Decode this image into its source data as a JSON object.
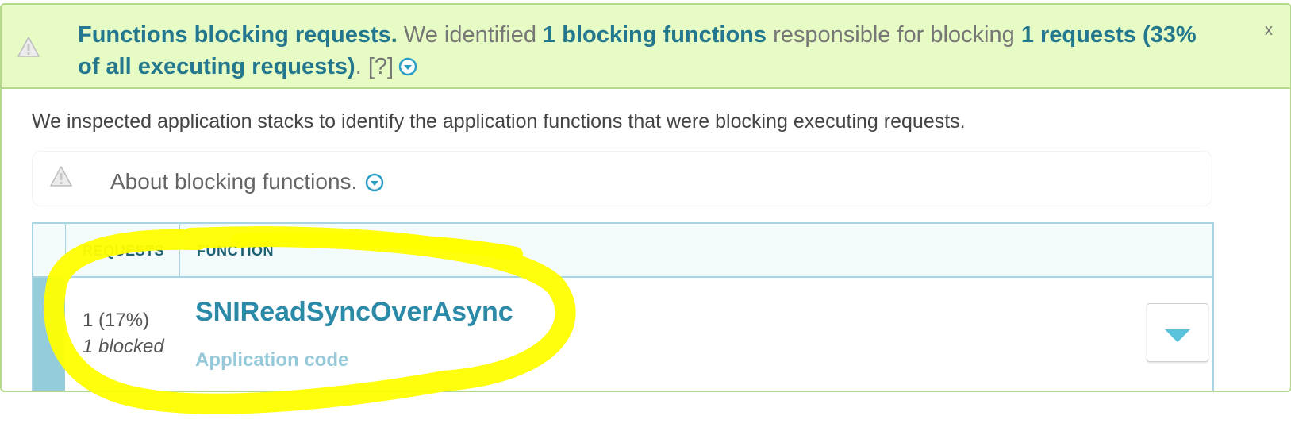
{
  "banner": {
    "title": "Functions blocking requests.",
    "text_1": " We identified ",
    "blocking_functions": "1 blocking functions",
    "text_2": " responsible for blocking ",
    "requests": "1 requests (33% of all executing requests)",
    "text_3": ". ",
    "help_link": "[?]",
    "close_label": "x",
    "icon": "warning-icon",
    "expand_icon": "chevron-down-circle-icon"
  },
  "description": "We inspected application stacks to identify the application functions that were blocking executing requests.",
  "about": {
    "label": "About blocking functions.",
    "icon": "warning-icon",
    "expand_icon": "chevron-down-circle-icon"
  },
  "table": {
    "headers": [
      "REQUESTS",
      "FUNCTION"
    ],
    "rows": [
      {
        "requests": "1 (17%)",
        "blocked": "1 blocked",
        "function": "SNIReadSyncOverAsync",
        "function_type": "Application code",
        "expand_icon": "triangle-down-icon"
      }
    ]
  },
  "colors": {
    "banner_bg": "#e7fbc4",
    "accent": "#23788f",
    "function_link": "#2a8aa8",
    "row_strip": "#95ccda",
    "annotation": "#ffff00"
  }
}
